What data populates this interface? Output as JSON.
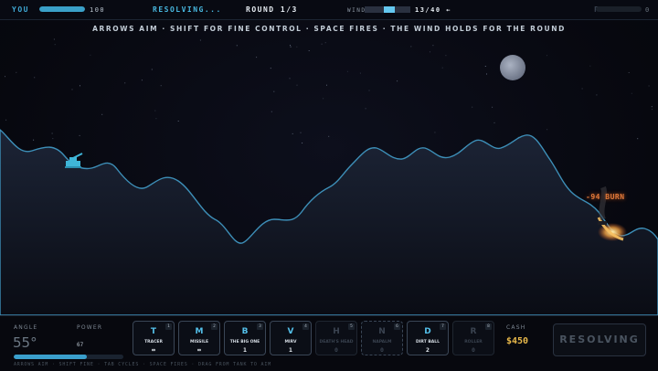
{
  "topbar": {
    "you_label": "YOU",
    "you_hp": "100",
    "you_hp_fraction": 1.0,
    "status": "RESOLVING...",
    "round": "ROUND 1/3",
    "wind_label": "WIND",
    "wind_value": "13/40 ←",
    "wind_fraction": 0.325,
    "foe_label": "FOE",
    "foe_hp": "0",
    "foe_hp_fraction": 0.0
  },
  "hint": "ARROWS AIM · SHIFT FOR FINE CONTROL · SPACE FIRES · THE WIND HOLDS FOR THE ROUND",
  "scene": {
    "burn_text": "-94 BURN",
    "colors": {
      "terrain_edge": "#3d8fb8",
      "player_tank": "#3fb6d8",
      "fire": "#f0a040",
      "moon": "#8a93a6"
    }
  },
  "hud": {
    "angle_label": "ANGLE",
    "angle_value": "55°",
    "power_label": "POWER",
    "power_value": "67",
    "power_fraction": 0.67,
    "footer": "ARROWS AIM · SHIFT FINE · TAB CYCLES · SPACE FIRES · DRAG FROM TANK TO AIM",
    "weapons": [
      {
        "key": "T",
        "num": "1",
        "name": "TRACER",
        "ammo": "∞",
        "dim": false,
        "dashed": false
      },
      {
        "key": "M",
        "num": "2",
        "name": "MISSILE",
        "ammo": "∞",
        "dim": false,
        "dashed": false
      },
      {
        "key": "B",
        "num": "3",
        "name": "THE BIG ONE",
        "ammo": "1",
        "dim": false,
        "dashed": false
      },
      {
        "key": "V",
        "num": "4",
        "name": "MIRV",
        "ammo": "1",
        "dim": false,
        "dashed": false
      },
      {
        "key": "H",
        "num": "5",
        "name": "DEATH'S HEAD",
        "ammo": "0",
        "dim": true,
        "dashed": false
      },
      {
        "key": "N",
        "num": "6",
        "name": "NAPALM",
        "ammo": "0",
        "dim": true,
        "dashed": true
      },
      {
        "key": "D",
        "num": "7",
        "name": "DIRT BALL",
        "ammo": "2",
        "dim": false,
        "dashed": false
      },
      {
        "key": "R",
        "num": "8",
        "name": "ROLLER",
        "ammo": "0",
        "dim": true,
        "dashed": false
      }
    ],
    "cash_label": "CASH",
    "cash_value": "$450",
    "fire_button": "RESOLVING"
  }
}
